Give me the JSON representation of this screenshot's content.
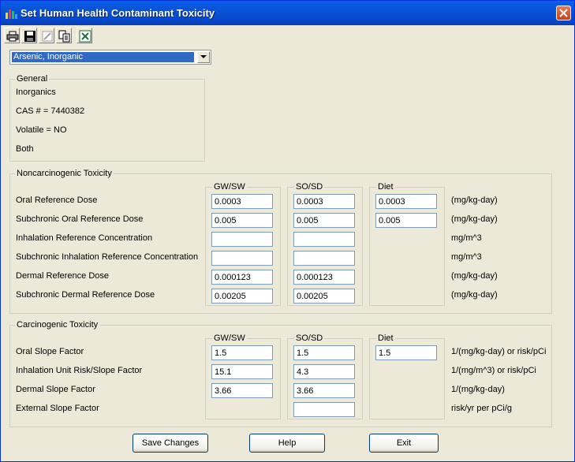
{
  "window": {
    "title": "Set Human Health Contaminant Toxicity"
  },
  "toolbar": {
    "buttons": [
      {
        "name": "printer-icon"
      },
      {
        "name": "save-disk-icon"
      },
      {
        "name": "edit-pencil-icon"
      },
      {
        "name": "copy-icon"
      },
      {
        "name": "excel-export-icon"
      }
    ]
  },
  "contaminant_select": {
    "value": "Arsenic, Inorganic"
  },
  "general": {
    "label": "General",
    "category": "Inorganics",
    "cas": "CAS # = 7440382",
    "volatile": "Volatile = NO",
    "scope": "Both"
  },
  "noncarc": {
    "label": "Noncarcinogenic Toxicity",
    "columns": {
      "gwsw": "GW/SW",
      "sosd": "SO/SD",
      "diet": "Diet"
    },
    "rows": [
      {
        "label": "Oral Reference Dose",
        "gwsw": "0.0003",
        "sosd": "0.0003",
        "diet": "0.0003",
        "unit": "(mg/kg-day)"
      },
      {
        "label": "Subchronic Oral Reference Dose",
        "gwsw": "0.005",
        "sosd": "0.005",
        "diet": "0.005",
        "unit": "(mg/kg-day)"
      },
      {
        "label": "Inhalation Reference Concentration",
        "gwsw": "",
        "sosd": "",
        "unit": "mg/m^3"
      },
      {
        "label": "Subchronic Inhalation Reference Concentration",
        "gwsw": "",
        "sosd": "",
        "unit": "mg/m^3"
      },
      {
        "label": "Dermal Reference Dose",
        "gwsw": "0.000123",
        "sosd": "0.000123",
        "unit": "(mg/kg-day)"
      },
      {
        "label": "Subchronic Dermal Reference Dose",
        "gwsw": "0.00205",
        "sosd": "0.00205",
        "unit": "(mg/kg-day)"
      }
    ]
  },
  "carc": {
    "label": "Carcinogenic Toxicity",
    "columns": {
      "gwsw": "GW/SW",
      "sosd": "SO/SD",
      "diet": "Diet"
    },
    "rows": [
      {
        "label": "Oral Slope Factor",
        "gwsw": "1.5",
        "sosd": "1.5",
        "diet": "1.5",
        "unit": "1/(mg/kg-day) or risk/pCi"
      },
      {
        "label": "Inhalation Unit Risk/Slope Factor",
        "gwsw": "15.1",
        "sosd": "4.3",
        "unit": "1/(mg/m^3) or risk/pCi"
      },
      {
        "label": "Dermal Slope Factor",
        "gwsw": "3.66",
        "sosd": "3.66",
        "unit": "1/(mg/kg-day)"
      },
      {
        "label": "External Slope Factor",
        "sosd": "",
        "unit": "risk/yr per pCi/g"
      }
    ]
  },
  "buttons": {
    "save": "Save Changes",
    "help": "Help",
    "exit": "Exit"
  }
}
